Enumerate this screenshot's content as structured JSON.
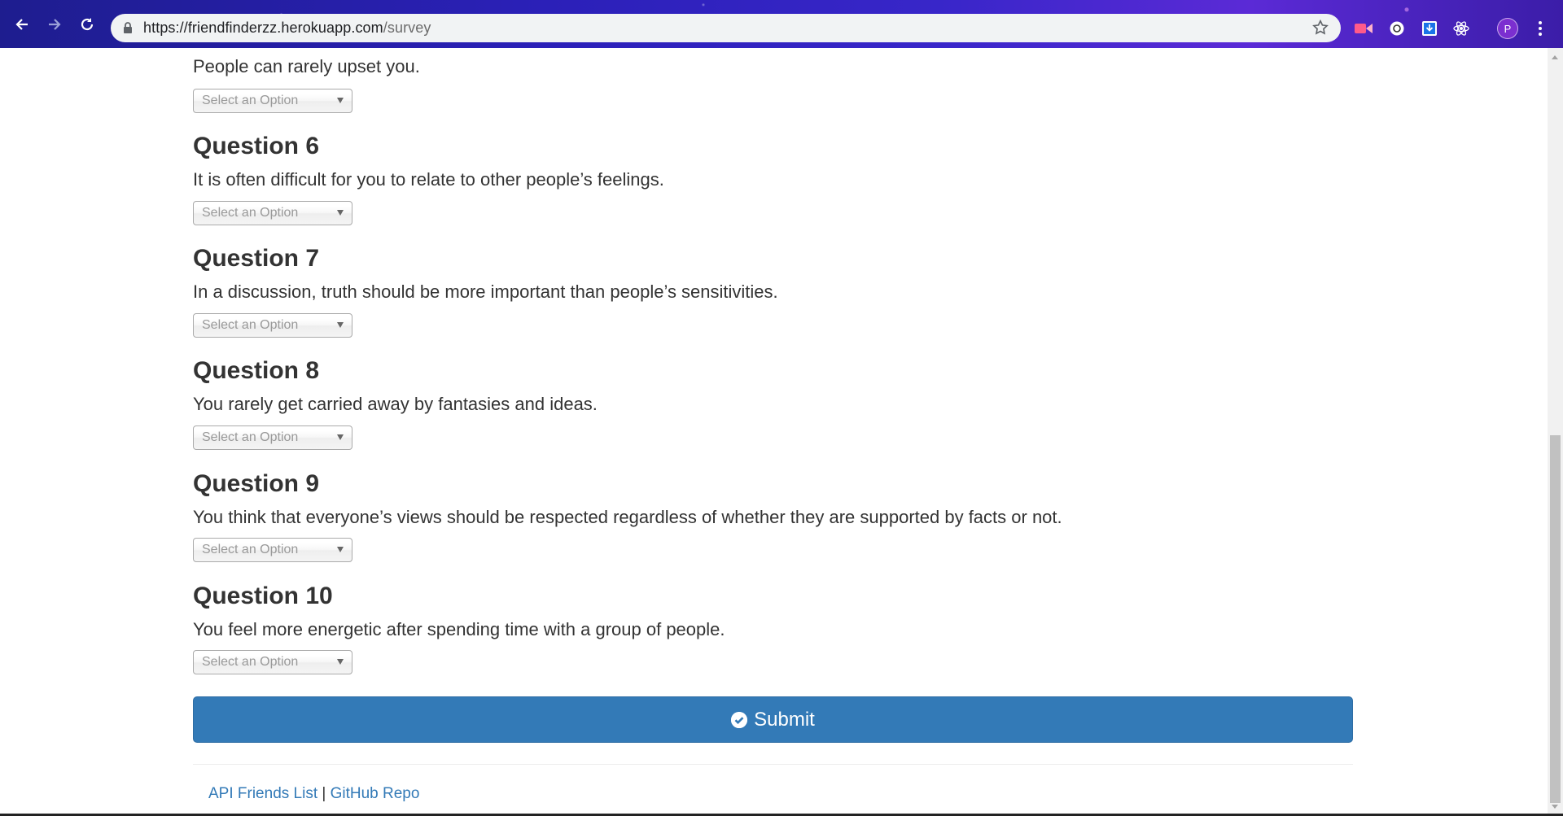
{
  "browser": {
    "url_host": "https://friendfinderzz.herokuapp.com",
    "url_path": "/survey",
    "profile_initial": "P"
  },
  "survey": {
    "partial_question_text": "People can rarely upset you.",
    "select_placeholder": "Select an Option",
    "questions": [
      {
        "heading": "Question 6",
        "text": "It is often difficult for you to relate to other people’s feelings."
      },
      {
        "heading": "Question 7",
        "text": "In a discussion, truth should be more important than people’s sensitivities."
      },
      {
        "heading": "Question 8",
        "text": "You rarely get carried away by fantasies and ideas."
      },
      {
        "heading": "Question 9",
        "text": "You think that everyone’s views should be respected regardless of whether they are supported by facts or not."
      },
      {
        "heading": "Question 10",
        "text": "You feel more energetic after spending time with a group of people."
      }
    ],
    "submit_label": "Submit"
  },
  "footer": {
    "link_api": "API Friends List",
    "separator": "|",
    "link_github": "GitHub Repo"
  },
  "colors": {
    "primary": "#337ab7",
    "text": "#333333"
  }
}
